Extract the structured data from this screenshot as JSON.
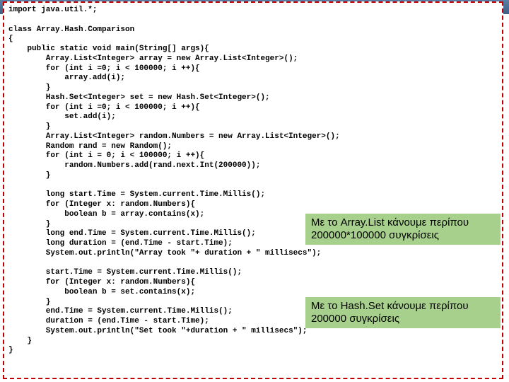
{
  "code": {
    "line01": "import java.util.*;",
    "line02": "",
    "line03": "class Array.Hash.Comparison",
    "line04": "{",
    "line05": "    public static void main(String[] args){",
    "line06": "        Array.List<Integer> array = new Array.List<Integer>();",
    "line07": "        for (int i =0; i < 100000; i ++){",
    "line08": "            array.add(i);",
    "line09": "        }",
    "line10": "        Hash.Set<Integer> set = new Hash.Set<Integer>();",
    "line11": "        for (int i =0; i < 100000; i ++){",
    "line12": "            set.add(i);",
    "line13": "        }",
    "line14": "        Array.List<Integer> random.Numbers = new Array.List<Integer>();",
    "line15": "        Random rand = new Random();",
    "line16": "        for (int i = 0; i < 100000; i ++){",
    "line17": "            random.Numbers.add(rand.next.Int(200000));",
    "line18": "        }",
    "line19": "",
    "line20": "        long start.Time = System.current.Time.Millis();",
    "line21": "        for (Integer x: random.Numbers){",
    "line22": "            boolean b = array.contains(x);",
    "line23": "        }",
    "line24": "        long end.Time = System.current.Time.Millis();",
    "line25": "        long duration = (end.Time - start.Time);",
    "line26": "        System.out.println(\"Array took \"+ duration + \" millisecs\");",
    "line27": "",
    "line28": "        start.Time = System.current.Time.Millis();",
    "line29": "        for (Integer x: random.Numbers){",
    "line30": "            boolean b = set.contains(x);",
    "line31": "        }",
    "line32": "        end.Time = System.current.Time.Millis();",
    "line33": "        duration = (end.Time - start.Time);",
    "line34": "        System.out.println(\"Set took \"+duration + \" millisecs\");",
    "line35": "    }",
    "line36": "}"
  },
  "callouts": {
    "c1_line1": "Με το Array.List κάνουμε περίπου",
    "c1_line2": "200000*100000 συγκρίσεις",
    "c2_line1": "Με το Hash.Set κάνουμε περίπου",
    "c2_line2": "200000 συγκρίσεις"
  }
}
